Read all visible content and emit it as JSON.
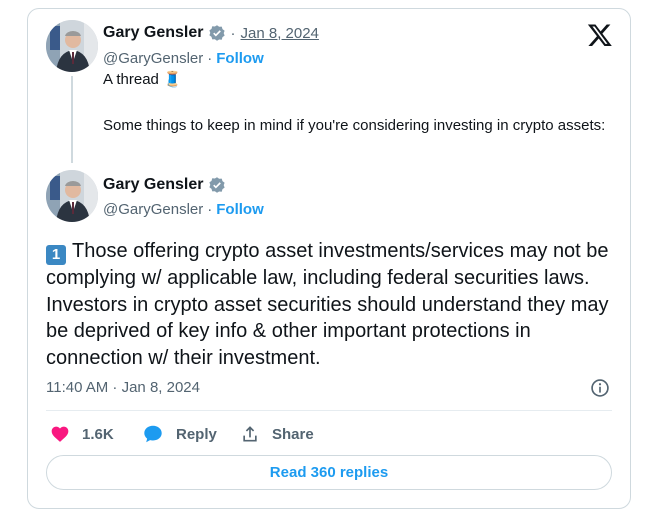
{
  "tweet1": {
    "name": "Gary Gensler",
    "separator": "·",
    "date": "Jan 8, 2024",
    "handle": "@GaryGensler",
    "handle_dot": "·",
    "follow": "Follow",
    "line1": "A thread 🧵",
    "line2": "Some things to keep in mind if you're considering investing in crypto assets:"
  },
  "tweet2": {
    "name": "Gary Gensler",
    "handle": "@GaryGensler",
    "handle_dot": "·",
    "follow": "Follow",
    "number_emoji": "1",
    "text": "Those offering crypto asset investments/services may not be complying w/ applicable law, including federal securities laws. Investors in crypto asset securities should understand they may be deprived of key info & other important protections in connection w/ their investment.",
    "timestamp": "11:40 AM · Jan 8, 2024"
  },
  "actions": {
    "likes": "1.6K",
    "reply": "Reply",
    "share": "Share"
  },
  "read_replies": "Read 360 replies",
  "icons": {
    "verified": "verified-badge-icon",
    "x_logo": "x-logo-icon",
    "info": "info-icon",
    "heart": "heart-icon",
    "reply": "reply-bubble-icon",
    "share": "share-icon"
  },
  "colors": {
    "accent": "#1d9bf0",
    "like": "#f91880",
    "muted": "#536471",
    "border": "#cfd9de"
  }
}
